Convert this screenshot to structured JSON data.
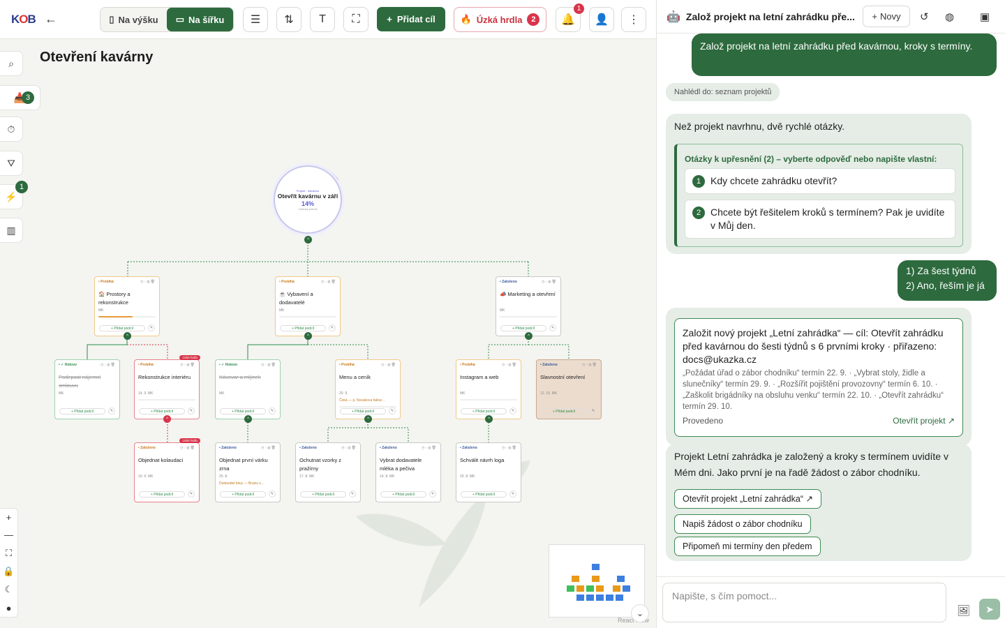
{
  "header": {
    "logo_main": "K",
    "logo_accent": "O",
    "logo_tail": "B",
    "view_portrait": "Na výšku",
    "view_landscape": "Na šířku",
    "add_goal": "Přidat cíl",
    "bottlenecks": "Úzká hrdla",
    "bottleneck_count": "2",
    "notif_count": "1"
  },
  "canvas": {
    "title": "Otevření kavárny",
    "inbox_count": "3",
    "actions_count": "1",
    "root": {
      "chip1": "Projekt",
      "chip2": "Založeno",
      "title": "Otevřít kavárnu v září",
      "percent": "14%",
      "sub": "Celkový pokrok"
    },
    "cards": [
      {
        "id": "prostory",
        "status": "• Probíhá",
        "name": "🏠 Prostory a rekonstrukce",
        "meta": "MK",
        "progress": 0.6,
        "progress_text": "60%",
        "variant": "orange"
      },
      {
        "id": "vybaveni",
        "status": "• Probíhá",
        "name": "☕ Vybavení a dodavatelé",
        "meta": "MK",
        "progress": 0,
        "progress_text": "0%",
        "variant": "orange"
      },
      {
        "id": "marketing",
        "status": "• Založeno",
        "name": "📣 Marketing a otevření",
        "meta": "MK",
        "progress": 0,
        "progress_text": "0%",
        "variant": "gray"
      },
      {
        "id": "smlouva",
        "status": "• ✓ Hotovo",
        "name": "Podepsat nájemní smlouvu",
        "meta": "MK",
        "done": true,
        "variant": "green"
      },
      {
        "id": "rekonstrukce",
        "status": "• Probíhá",
        "name": "Rekonstrukce interiéru",
        "meta": "14. 9.  MK",
        "progress": 0,
        "progress_text": "0%",
        "variant": "red",
        "tag": "Úzké hrdlo"
      },
      {
        "id": "kavovar",
        "status": "• ✓ Hotovo",
        "name": "Kávovar a mlýnek",
        "meta": "MK",
        "done": true,
        "variant": "green"
      },
      {
        "id": "menu",
        "status": "• Probíhá",
        "name": "Menu a ceník",
        "meta": "20. 9.",
        "note": "Čeká — p. Novákova faktur...",
        "progress": 0,
        "progress_text": "0%",
        "variant": "orange"
      },
      {
        "id": "instagram",
        "status": "• Probíhá",
        "name": "Instagram a web",
        "meta": "MK",
        "progress": 0,
        "progress_text": "0%",
        "variant": "orange"
      },
      {
        "id": "slavnostni",
        "status": "• Založeno",
        "name": "Slavnostní otevření",
        "meta": "12. 10.  MK",
        "variant": "tan"
      },
      {
        "id": "kolaudace",
        "status": "• Založeno",
        "name": "Objednat kolaudaci",
        "meta": "10. 9.  MK",
        "variant": "red",
        "tag": "Úzké hrdlo"
      },
      {
        "id": "zrna",
        "status": "• Založeno",
        "name": "Objednat první várku zrna",
        "meta": "25. 8.",
        "note": "Dodavatel kávy — Brazis s...",
        "variant": "gray"
      },
      {
        "id": "vzorky",
        "status": "• Založeno",
        "name": "Ochutnat vzorky z pražírny",
        "meta": "17. 8.  MK",
        "variant": "gray"
      },
      {
        "id": "mleko",
        "status": "• Založeno",
        "name": "Vybrat dodavatele mléka a pečiva",
        "meta": "14. 8.  MK",
        "variant": "gray"
      },
      {
        "id": "logo",
        "status": "• Založeno",
        "name": "Schválit návrh loga",
        "meta": "20. 8.  MK",
        "variant": "gray"
      }
    ],
    "add_sub": "+ Přidat podcíl",
    "reactflow": "React Flow"
  },
  "panel": {
    "title": "Založ projekt na letní zahrádku pře...",
    "new_label": "Novy",
    "user_msg_1": "Založ projekt na letní zahrádku před kavárnou, kroky s termíny.",
    "peek": "Nahlédl do: seznam projektů",
    "assistant_intro": "Než projekt navrhnu, dvě rychlé otázky.",
    "questions_header": "Otázky k upřesnění (2) – vyberte odpověď nebo napište vlastní:",
    "q1": "Kdy chcete zahrádku otevřít?",
    "q2": "Chcete být řešitelem kroků s termínem? Pak je uvidíte v Můj den.",
    "user_answer_1": "1) Za šest týdnů",
    "user_answer_2": "2) Ano, řeším je já",
    "action_title": "Založit nový projekt „Letní zahrádka“ — cíl: Otevřít zahrádku před kavárnou do šesti týdnů s 6 prvními kroky · přiřazeno: docs@ukazka.cz",
    "action_detail": "„Požádat úřad o zábor chodníku“ termín 22. 9. · „Vybrat stoly, židle a slunečníky“ termín 29. 9. · „Rozšířit pojištění provozovny“ termín 6. 10. · „Zaškolit brigádníky na obsluhu venku“ termín 22. 10. · „Otevřít zahrádku“ termín 29. 10.",
    "action_status": "Provedeno",
    "action_open": "Otevřít projekt",
    "final_msg": "Projekt Letní zahrádka je založený a kroky s termínem uvidíte v Mém dni. Jako první je na řadě žádost o zábor chodníku.",
    "chip1": "Otevřít projekt „Letní zahrádka“",
    "chip2": "Napiš žádost o zábor chodníku",
    "chip3": "Připomeň mi termíny den předem",
    "input_placeholder": "Napište, s čím pomoct..."
  }
}
